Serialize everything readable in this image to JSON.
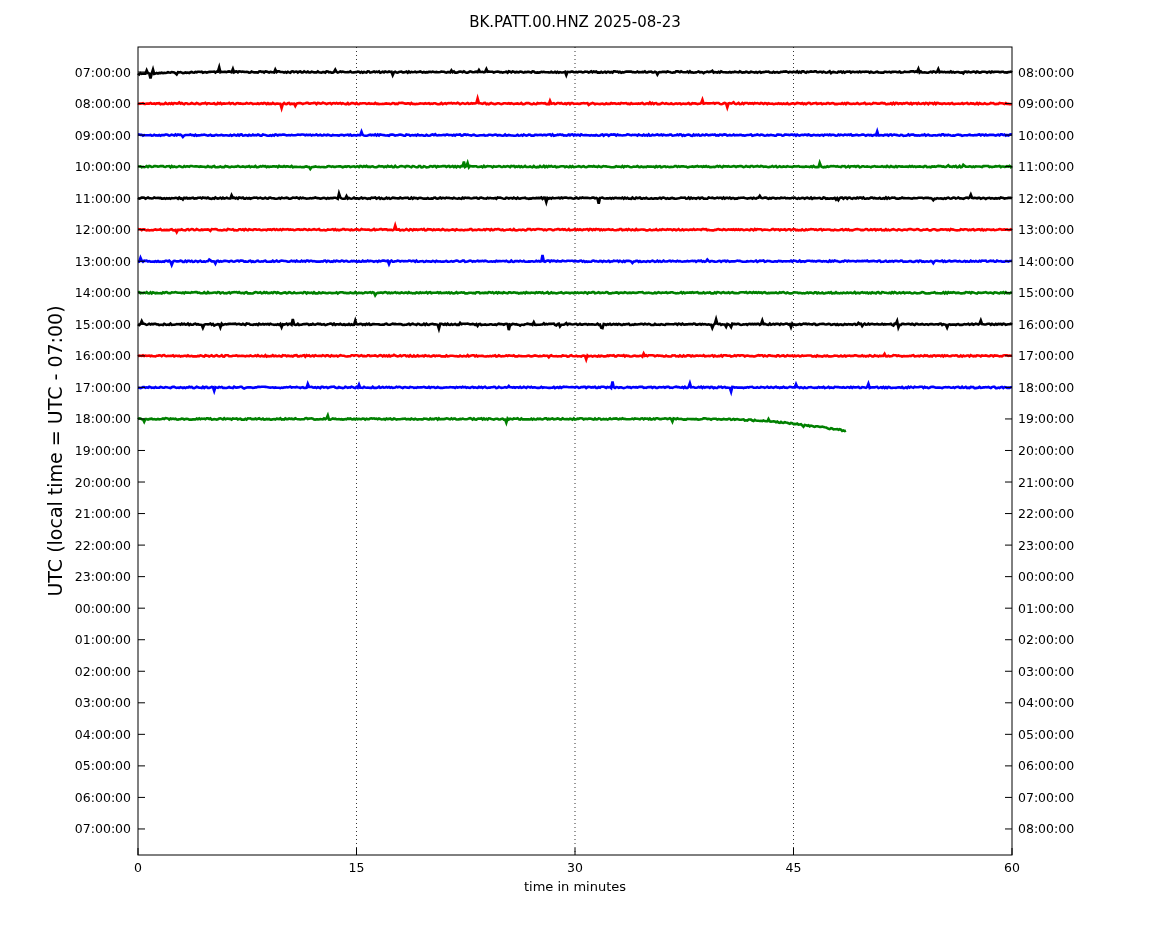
{
  "title": "BK.PATT.00.HNZ 2025-08-23",
  "ylabel": "UTC (local time = UTC - 07:00)",
  "xlabel": "time in minutes",
  "xticks": [
    "0",
    "15",
    "30",
    "45",
    "60"
  ],
  "left_ticks": [
    "07:00:00",
    "08:00:00",
    "09:00:00",
    "10:00:00",
    "11:00:00",
    "12:00:00",
    "13:00:00",
    "14:00:00",
    "15:00:00",
    "16:00:00",
    "17:00:00",
    "18:00:00",
    "19:00:00",
    "20:00:00",
    "21:00:00",
    "22:00:00",
    "23:00:00",
    "00:00:00",
    "01:00:00",
    "02:00:00",
    "03:00:00",
    "04:00:00",
    "05:00:00",
    "06:00:00",
    "07:00:00"
  ],
  "right_ticks": [
    "08:00:00",
    "09:00:00",
    "10:00:00",
    "11:00:00",
    "12:00:00",
    "13:00:00",
    "14:00:00",
    "15:00:00",
    "16:00:00",
    "17:00:00",
    "18:00:00",
    "19:00:00",
    "20:00:00",
    "21:00:00",
    "22:00:00",
    "23:00:00",
    "00:00:00",
    "01:00:00",
    "02:00:00",
    "03:00:00",
    "04:00:00",
    "05:00:00",
    "06:00:00",
    "07:00:00",
    "08:00:00"
  ],
  "traces": [
    {
      "color": "#000000",
      "kind": "full"
    },
    {
      "color": "#ff0000",
      "kind": "full"
    },
    {
      "color": "#0000ff",
      "kind": "full"
    },
    {
      "color": "#008000",
      "kind": "full"
    },
    {
      "color": "#000000",
      "kind": "full"
    },
    {
      "color": "#ff0000",
      "kind": "full"
    },
    {
      "color": "#0000ff",
      "kind": "full"
    },
    {
      "color": "#008000",
      "kind": "full"
    },
    {
      "color": "#000000",
      "kind": "full"
    },
    {
      "color": "#ff0000",
      "kind": "full"
    },
    {
      "color": "#0000ff",
      "kind": "full"
    },
    {
      "color": "#008000",
      "kind": "partial"
    }
  ]
}
